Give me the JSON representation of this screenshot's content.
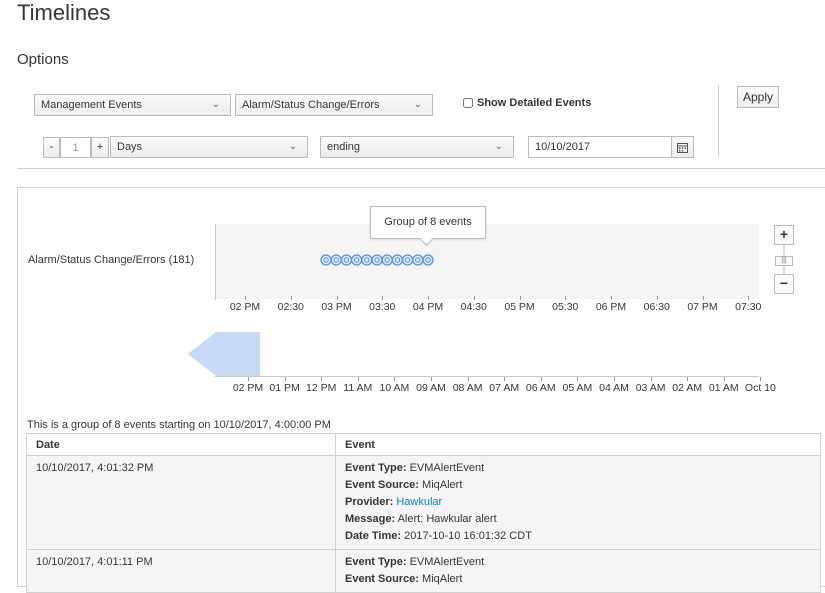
{
  "page": {
    "title": "Timelines",
    "options_title": "Options"
  },
  "filters": {
    "event_type": "Management Events",
    "event_group": "Alarm/Status Change/Errors",
    "show_detailed_label": "Show Detailed Events",
    "show_detailed_checked": false,
    "apply_label": "Apply",
    "minus_label": "-",
    "plus_label": "+",
    "interval_value": "1",
    "interval_unit": "Days",
    "position": "ending",
    "date": "10/10/2017"
  },
  "timeline": {
    "row_label": "Alarm/Status Change/Errors (181)",
    "tooltip": "Group of 8 events",
    "event_markers": 11,
    "top_ticks": [
      "02 PM",
      "02:30",
      "03 PM",
      "03:30",
      "04 PM",
      "04:30",
      "05 PM",
      "05:30",
      "06 PM",
      "06:30",
      "07 PM",
      "07:30"
    ],
    "bottom_ticks": [
      "02 PM",
      "01 PM",
      "12 PM",
      "11 AM",
      "10 AM",
      "09 AM",
      "08 AM",
      "07 AM",
      "06 AM",
      "05 AM",
      "04 AM",
      "03 AM",
      "02 AM",
      "01 AM",
      "Oct 10"
    ],
    "zoom_in": "+",
    "zoom_out": "−",
    "zoom_level": 0.5
  },
  "details": {
    "summary": "This is a group of 8 events starting on 10/10/2017, 4:00:00 PM",
    "columns": [
      "Date",
      "Event"
    ],
    "labels": {
      "type": "Event Type:",
      "source": "Event Source:",
      "provider": "Provider:",
      "message": "Message:",
      "datetime": "Date Time:"
    },
    "rows": [
      {
        "date": "10/10/2017, 4:01:32 PM",
        "type": "EVMAlertEvent",
        "source": "MiqAlert",
        "provider": "Hawkular",
        "message": "Alert: Hawkular alert",
        "datetime": "2017-10-10 16:01:32 CDT"
      },
      {
        "date": "10/10/2017, 4:01:11 PM",
        "type": "EVMAlertEvent",
        "source": "MiqAlert"
      }
    ]
  },
  "colors": {
    "accent": "#0088ce",
    "marker": "#5b8fd6",
    "band": "#c6d9f5"
  }
}
